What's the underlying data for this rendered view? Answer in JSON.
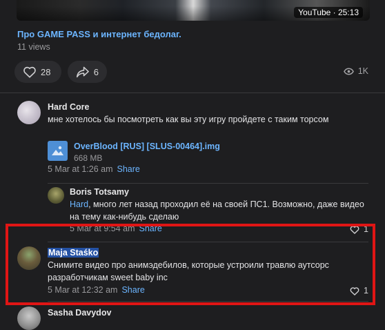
{
  "video": {
    "badge": "YouTube · 25:13",
    "title": "Про GAME PASS и интернет бедолаг.",
    "views": "11 views"
  },
  "reactions": {
    "likes": "28",
    "shares": "6",
    "views": "1K"
  },
  "comments": [
    {
      "author": "Hard Core",
      "text": "мне хотелось бы посмотреть как вы эту игру пройдете с таким торсом",
      "attachment": {
        "name": "OverBlood [RUS] [SLUS-00464].img",
        "size": "668 MB"
      },
      "date": "5 Mar at 1:26 am",
      "share": "Share",
      "reply": {
        "author": "Boris Totsamy",
        "mention": "Hard",
        "text": ", много лет назад проходил её на своей ПС1. Возможно, даже видео на тему как-нибудь сделаю",
        "date": "5 Mar at 9:54 am",
        "share": "Share",
        "likes": "1"
      }
    },
    {
      "author": "Maja Staśko",
      "text": "Снимите видео про анимэдебилов, которые устроили травлю аутсорс разработчикам sweet baby inc",
      "date": "5 Mar at 12:32 am",
      "share": "Share",
      "likes": "1"
    },
    {
      "author": "Sasha Davydov"
    }
  ],
  "icons": {
    "heart": "heart-icon",
    "share": "share-arrow-icon",
    "eye": "eye-icon",
    "file": "image-file-icon"
  },
  "colors": {
    "link": "#6cb5ff",
    "highlight_border": "#e01515",
    "selection": "#2552a4"
  }
}
